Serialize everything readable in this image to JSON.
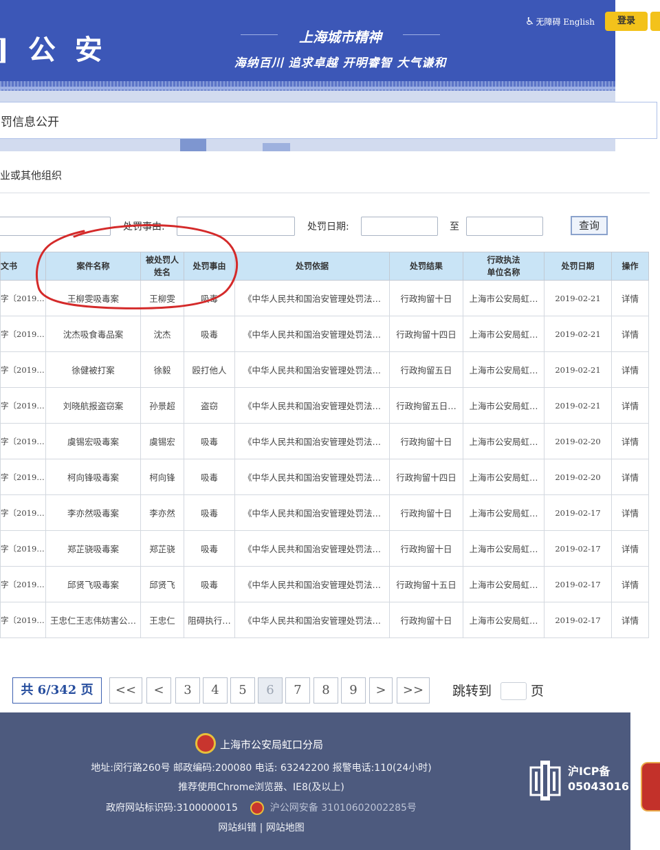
{
  "header": {
    "site_name": "]公安",
    "spirit_title": "上海城市精神",
    "spirit_motto": "海纳百川 追求卓越 开明睿智 大气谦和",
    "accessibility": "无障碍",
    "english": "English",
    "login": "登录"
  },
  "page": {
    "title": "罚信息公开",
    "subject_type": "业或其他组织"
  },
  "filters": {
    "reason_label": "处罚事由:",
    "date_label": "处罚日期:",
    "to_label": "至",
    "query_button": "查询",
    "first_input_value": "",
    "reason_value": "",
    "date_from": "",
    "date_to": ""
  },
  "table": {
    "headers": [
      "文书",
      "案件名称",
      "被处罚人姓名",
      "处罚事由",
      "处罚依据",
      "处罚结果",
      "行政执法单位名称",
      "处罚日期",
      "操作"
    ],
    "header_lines": {
      "punished_line1": "被处罚人",
      "punished_line2": "姓名",
      "unit_line1": "行政执法",
      "unit_line2": "单位名称"
    },
    "rows": [
      {
        "doc": "字〔2019…",
        "case": "王柳雯吸毒案",
        "name": "王柳雯",
        "reason": "吸毒",
        "basis": "《中华人民共和国治安管理处罚法…",
        "result": "行政拘留十日",
        "unit": "上海市公安局虹…",
        "date": "2019-02-21",
        "action": "详情"
      },
      {
        "doc": "字〔2019…",
        "case": "沈杰吸食毒品案",
        "name": "沈杰",
        "reason": "吸毒",
        "basis": "《中华人民共和国治安管理处罚法…",
        "result": "行政拘留十四日",
        "unit": "上海市公安局虹…",
        "date": "2019-02-21",
        "action": "详情"
      },
      {
        "doc": "字〔2019…",
        "case": "徐健被打案",
        "name": "徐毅",
        "reason": "殴打他人",
        "basis": "《中华人民共和国治安管理处罚法…",
        "result": "行政拘留五日",
        "unit": "上海市公安局虹…",
        "date": "2019-02-21",
        "action": "详情"
      },
      {
        "doc": "字〔2019…",
        "case": "刘晓航报盗窃案",
        "name": "孙景超",
        "reason": "盗窃",
        "basis": "《中华人民共和国治安管理处罚法…",
        "result": "行政拘留五日…",
        "unit": "上海市公安局虹…",
        "date": "2019-02-21",
        "action": "详情"
      },
      {
        "doc": "字〔2019…",
        "case": "虞锡宏吸毒案",
        "name": "虞锡宏",
        "reason": "吸毒",
        "basis": "《中华人民共和国治安管理处罚法…",
        "result": "行政拘留十日",
        "unit": "上海市公安局虹…",
        "date": "2019-02-20",
        "action": "详情"
      },
      {
        "doc": "字〔2019…",
        "case": "柯向锋吸毒案",
        "name": "柯向锋",
        "reason": "吸毒",
        "basis": "《中华人民共和国治安管理处罚法…",
        "result": "行政拘留十四日",
        "unit": "上海市公安局虹…",
        "date": "2019-02-20",
        "action": "详情"
      },
      {
        "doc": "字〔2019…",
        "case": "李亦然吸毒案",
        "name": "李亦然",
        "reason": "吸毒",
        "basis": "《中华人民共和国治安管理处罚法…",
        "result": "行政拘留十日",
        "unit": "上海市公安局虹…",
        "date": "2019-02-17",
        "action": "详情"
      },
      {
        "doc": "字〔2019…",
        "case": "郑芷骁吸毒案",
        "name": "郑芷骁",
        "reason": "吸毒",
        "basis": "《中华人民共和国治安管理处罚法…",
        "result": "行政拘留十日",
        "unit": "上海市公安局虹…",
        "date": "2019-02-17",
        "action": "详情"
      },
      {
        "doc": "字〔2019…",
        "case": "邱贤飞吸毒案",
        "name": "邱贤飞",
        "reason": "吸毒",
        "basis": "《中华人民共和国治安管理处罚法…",
        "result": "行政拘留十五日",
        "unit": "上海市公安局虹…",
        "date": "2019-02-17",
        "action": "详情"
      },
      {
        "doc": "字〔2019…",
        "case": "王忠仁王志伟妨害公…",
        "name": "王忠仁",
        "reason": "阻碍执行…",
        "basis": "《中华人民共和国治安管理处罚法…",
        "result": "行政拘留十日",
        "unit": "上海市公安局虹…",
        "date": "2019-02-17",
        "action": "详情"
      }
    ]
  },
  "pagination": {
    "total": "共 6/342 页",
    "first": "<<",
    "prev": "<",
    "pages": [
      "3",
      "4",
      "5",
      "6",
      "7",
      "8",
      "9"
    ],
    "current_page": "6",
    "next": ">",
    "last": ">>",
    "jump_label": "跳转到",
    "page_unit": "页",
    "jump_value": ""
  },
  "footer": {
    "org": "上海市公安局虹口分局",
    "address": "地址:闵行路260号 邮政编码:200080 电话: 63242200 报警电话:110(24小时)",
    "browser": "推荐使用Chrome浏览器、IE8(及以上)",
    "gov_id": "政府网站标识码:3100000015",
    "police_record": "沪公网安备 31010602002285号",
    "links": [
      "网站纠错",
      "网站地图"
    ],
    "link_separator": "|",
    "icp_line1": "沪ICP备",
    "icp_line2": "05043016"
  },
  "colors": {
    "header_blue": "#3c57b7",
    "table_header": "#c9e4f6",
    "footer_bg": "#4d5a7e",
    "login_yellow": "#f3c21b",
    "annotation_red": "#d42a2a"
  }
}
